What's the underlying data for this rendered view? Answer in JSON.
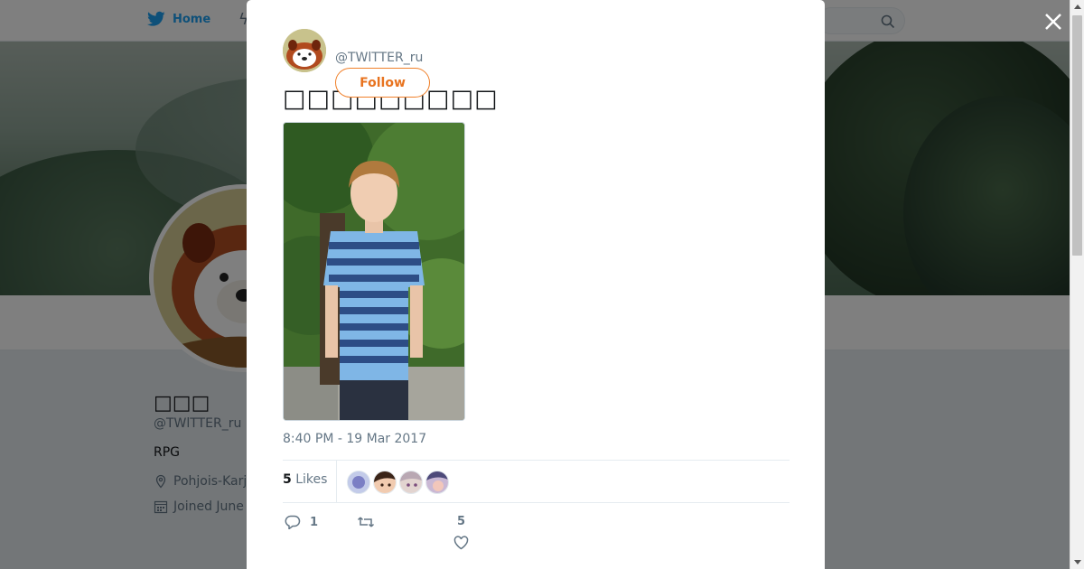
{
  "nav": {
    "home_label": "Home",
    "search_icon": "search-icon"
  },
  "profile": {
    "name": "□□□",
    "handle": "@TWlTTER_ru",
    "bio": "RPG",
    "location": "Pohjois-Karj",
    "joined": "Joined June"
  },
  "tweet": {
    "handle": "@TWlTTER_ru",
    "follow_label": "Follow",
    "text": "□□□□□□□□□",
    "timestamp": "8:40 PM - 19 Mar 2017",
    "likes_count": "5",
    "likes_label": "Likes",
    "reply_count": "1",
    "retweet_count": "",
    "like_count": "5"
  },
  "colors": {
    "accent": "#1da1f2",
    "follow": "#e8731f",
    "muted": "#657786"
  }
}
